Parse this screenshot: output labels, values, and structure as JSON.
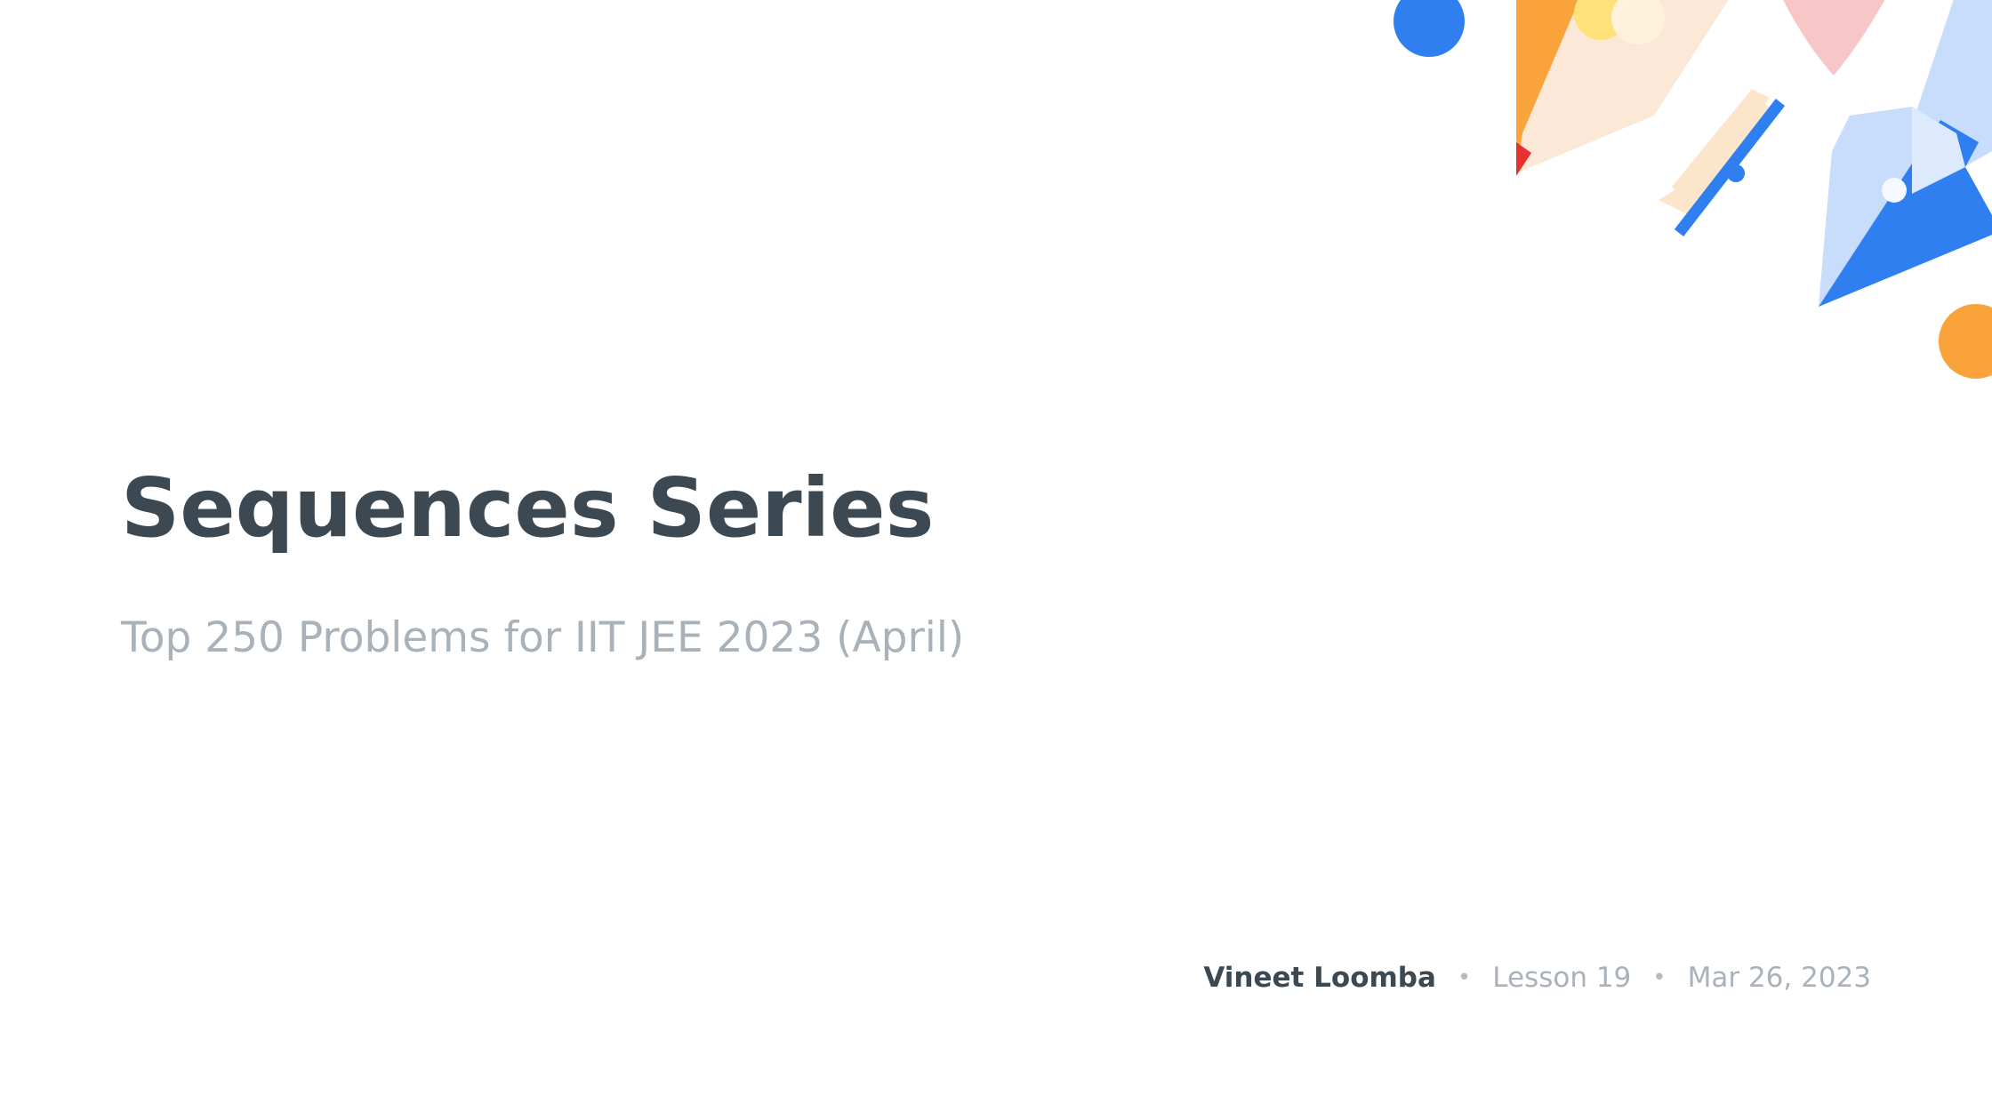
{
  "slide": {
    "title": "Sequences Series",
    "subtitle": "Top 250 Problems for IIT JEE 2023 (April)",
    "author": "Vineet Loomba",
    "separator": "•",
    "lesson": "Lesson 19",
    "date": "Mar 26, 2023"
  },
  "colors": {
    "title": "#3c4852",
    "muted": "#a9b2bb",
    "accent_blue": "#2f7ff0",
    "accent_orange": "#f9a33a",
    "accent_pink": "#f7c6c6",
    "accent_light_blue": "#c8dcfb",
    "accent_yellow": "#fde27a",
    "accent_red": "#e8312f"
  },
  "decoration_icons": [
    "pencil-icon",
    "fountain-pen-icon",
    "scale-bar-icon",
    "blue-dot-icon",
    "orange-dot-icon",
    "pink-shape-icon"
  ]
}
